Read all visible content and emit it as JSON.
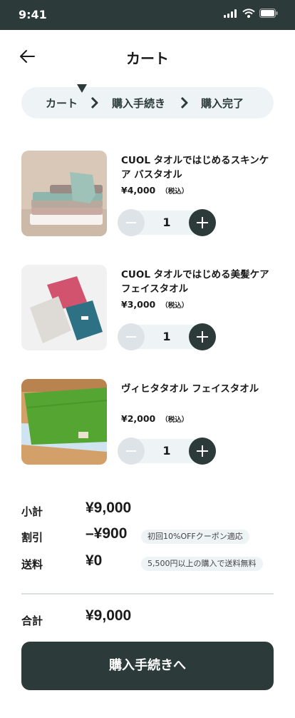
{
  "status_bar": {
    "time": "9:41"
  },
  "header": {
    "title": "カート"
  },
  "stepper": {
    "steps": [
      "カート",
      "購入手続き",
      "購入完了"
    ],
    "current": "カート"
  },
  "cart": {
    "items": [
      {
        "name": "CUOL タオルではじめるスキンケア バスタオル",
        "price": "¥4,000",
        "tax_label": "（税込）",
        "quantity": "1",
        "image": "stacked-bath-towels-photo"
      },
      {
        "name": "CUOL タオルではじめる美髪ケア フェイスタオル",
        "price": "¥3,000",
        "tax_label": "（税込）",
        "quantity": "1",
        "image": "folded-face-towels-photo"
      },
      {
        "name": "ヴィヒタタオル フェイスタオル",
        "price": "¥2,000",
        "tax_label": "（税込）",
        "quantity": "1",
        "image": "green-face-towel-photo"
      }
    ]
  },
  "summary": {
    "subtotal": {
      "label": "小計",
      "value": "¥9,000"
    },
    "discount": {
      "label": "割引",
      "value": "–¥900",
      "note": "初回10%OFFクーポン適応"
    },
    "shipping": {
      "label": "送料",
      "value": "¥0",
      "note": "5,500円以上の購入で送料無料"
    },
    "total": {
      "label": "合計",
      "value": "¥9,000"
    }
  },
  "checkout": {
    "label": "購入手続きへ"
  },
  "colors": {
    "primary": "#2c3b39",
    "surface": "#eef3f6",
    "disabled": "#dde3e7"
  }
}
